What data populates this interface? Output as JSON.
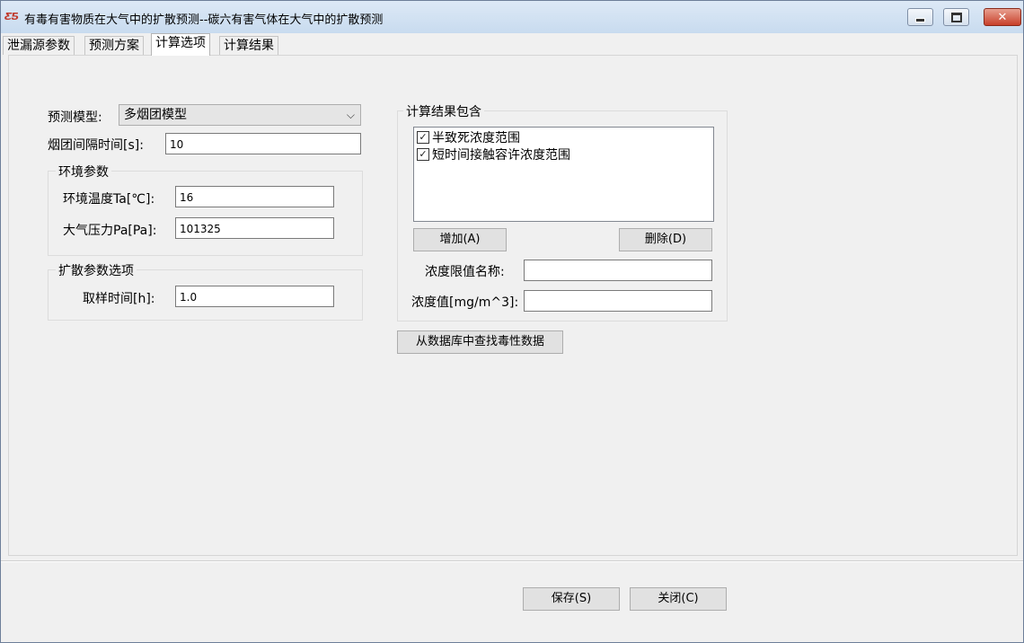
{
  "window": {
    "title": "有毒有害物质在大气中的扩散预测--碳六有害气体在大气中的扩散预测",
    "app_icon_text": "ƸƼ",
    "min_icon": "minimize-icon",
    "max_icon": "maximize-icon",
    "close_glyph": "✕"
  },
  "tabs": [
    {
      "label": "泄漏源参数"
    },
    {
      "label": "预测方案"
    },
    {
      "label": "计算选项"
    },
    {
      "label": "计算结果"
    }
  ],
  "left": {
    "model_label": "预测模型:",
    "model_value": "多烟团模型",
    "interval_label": "烟团间隔时间[s]:",
    "interval_value": "10",
    "env_group_title": "环境参数",
    "temp_label": "环境温度Ta[℃]:",
    "temp_value": "16",
    "pressure_label": "大气压力Pa[Pa]:",
    "pressure_value": "101325",
    "diff_group_title": "扩散参数选项",
    "sample_label": "取样时间[h]:",
    "sample_value": "1.0"
  },
  "right": {
    "group_title": "计算结果包含",
    "items": [
      {
        "label": "半致死浓度范围",
        "checked": true
      },
      {
        "label": "短时间接触容许浓度范围",
        "checked": true
      }
    ],
    "check_glyph": "✓",
    "add_button": "增加(A)",
    "delete_button": "删除(D)",
    "limit_name_label": "浓度限值名称:",
    "limit_name_value": "",
    "conc_label": "浓度值[mg/m^3]:",
    "conc_value": "",
    "lookup_button": "从数据库中查找毒性数据"
  },
  "footer": {
    "save_button": "保存(S)",
    "close_button": "关闭(C)"
  }
}
